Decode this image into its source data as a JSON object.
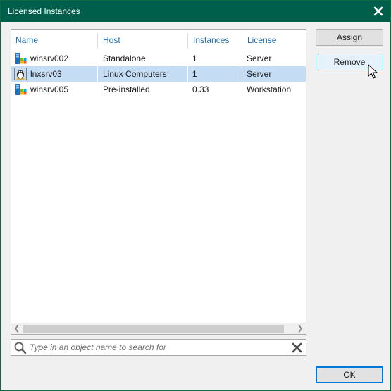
{
  "window": {
    "title": "Licensed Instances",
    "close_icon": "close-icon"
  },
  "table": {
    "columns": [
      "Name",
      "Host",
      "Instances",
      "License"
    ],
    "rows": [
      {
        "icon": "windows-server-icon",
        "name": "winsrv002",
        "host": "Standalone",
        "instances": "1",
        "license": "Server",
        "selected": false
      },
      {
        "icon": "linux-penguin-icon",
        "name": "lnxsrv03",
        "host": "Linux Computers",
        "instances": "1",
        "license": "Server",
        "selected": true
      },
      {
        "icon": "windows-server-icon",
        "name": "winsrv005",
        "host": "Pre-installed",
        "instances": "0.33",
        "license": "Workstation",
        "selected": false
      }
    ]
  },
  "search": {
    "placeholder": "Type in an object name to search for",
    "value": ""
  },
  "buttons": {
    "assign": "Assign",
    "remove": "Remove",
    "ok": "OK"
  },
  "colors": {
    "titlebar": "#005f4b",
    "selected_row": "#c5dcf5",
    "column_header_text": "#1f6fb5"
  }
}
